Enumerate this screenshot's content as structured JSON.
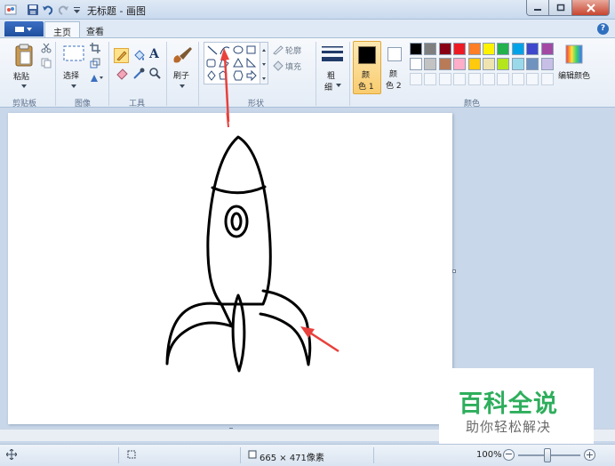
{
  "window": {
    "title": "无标题 - 画图"
  },
  "tabs": {
    "home": "主页",
    "view": "查看"
  },
  "clipboard": {
    "paste": "粘贴",
    "group": "剪贴板"
  },
  "image": {
    "select": "选择",
    "group": "图像"
  },
  "tools": {
    "group": "工具"
  },
  "brushes": {
    "label": "刷子"
  },
  "shapes": {
    "outline": "轮廓",
    "fill": "填充",
    "group": "形状"
  },
  "size": {
    "label_line1": "粗",
    "label_line2": "细"
  },
  "colors": {
    "color1_line1": "颜",
    "color1_line2": "色 1",
    "color2_line1": "颜",
    "color2_line2": "色 2",
    "edit": "编辑颜色",
    "group": "颜色",
    "color1_value": "#000000",
    "color2_value": "#ffffff",
    "palette_row1": [
      "#000000",
      "#7f7f7f",
      "#880015",
      "#ed1c24",
      "#ff7f27",
      "#fff200",
      "#22b14c",
      "#00a2e8",
      "#3f48cc",
      "#a349a4"
    ],
    "palette_row2": [
      "#ffffff",
      "#c3c3c3",
      "#b97a57",
      "#ffaec9",
      "#ffc90e",
      "#efe4b0",
      "#b5e61d",
      "#99d9ea",
      "#7092be",
      "#c8bfe7"
    ]
  },
  "status": {
    "dimensions": "665 × 471像素",
    "zoom": "100%"
  },
  "watermark": {
    "title": "百科全说",
    "subtitle": "助你轻松解决"
  },
  "accent": {
    "arrow": "#e8403c",
    "ribbon": "#dfe9f5",
    "tab_menu": "#2a5ab0"
  }
}
